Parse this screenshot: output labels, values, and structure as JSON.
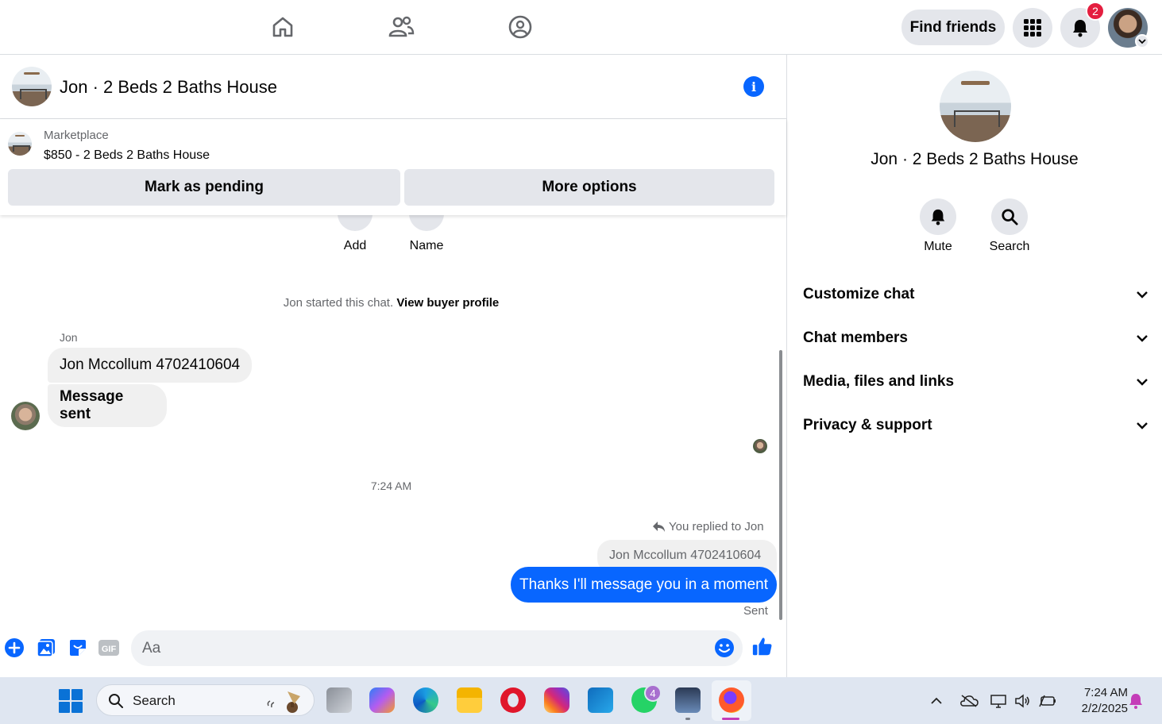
{
  "topbar": {
    "find_friends": "Find friends",
    "notification_count": "2"
  },
  "chat": {
    "title": "Jon · 2 Beds 2 Baths House",
    "marketplace_label": "Marketplace",
    "listing": "$850 - 2 Beds 2 Baths House",
    "mark_pending": "Mark as pending",
    "more_options": "More options",
    "actions": [
      {
        "label": "Add"
      },
      {
        "label": "Name"
      }
    ],
    "started_text": "Jon started this chat.",
    "view_buyer_profile": "View buyer profile",
    "sender": "Jon",
    "incoming": [
      "Jon Mccollum  4702410604",
      "Message sent"
    ],
    "timestamp": "7:24 AM",
    "replied_to": "You replied to Jon",
    "quoted": "Jon Mccollum  4702410604",
    "outgoing": "Thanks I'll message you in a moment",
    "status": "Sent",
    "composer_placeholder": "Aa"
  },
  "side_panel": {
    "name": "Jon · 2 Beds 2 Baths House",
    "mute": "Mute",
    "search": "Search",
    "sections": [
      "Customize chat",
      "Chat members",
      "Media, files and links",
      "Privacy & support"
    ]
  },
  "taskbar": {
    "search": "Search",
    "whatsapp_badge": "4",
    "time": "7:24 AM",
    "date": "2/2/2025"
  },
  "colors": {
    "accent": "#0866ff",
    "badge": "#e41e3f"
  }
}
